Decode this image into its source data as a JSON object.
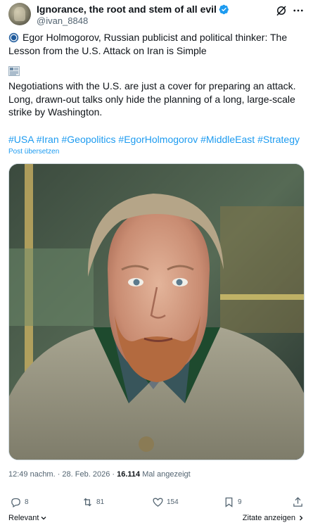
{
  "author": {
    "display_name": "Ignorance, the root and stem of all evil",
    "handle": "@ivan_8848"
  },
  "post": {
    "line1": "Egor Holmogorov, Russian publicist and political thinker: The Lesson from the U.S. Attack on Iran is Simple",
    "paragraph": "Negotiations with the U.S. are just a cover for preparing an attack. Long, drawn-out talks only hide the planning of a long, large-scale strike by Washington.",
    "hashtags": "#USA #Iran #Geopolitics #EgorHolmogorov #MiddleEast #Strategy",
    "translate_label": "Post übersetzen"
  },
  "meta": {
    "time_date": "12:49 nachm. · 28. Feb. 2026 · ",
    "views_count": "16.114",
    "views_label": " Mal angezeigt"
  },
  "actions": {
    "replies": "8",
    "reposts": "81",
    "likes": "154",
    "bookmarks": "9"
  },
  "footer": {
    "sort_label": "Relevant",
    "quotes_label": "Zitate anzeigen"
  },
  "colors": {
    "accent": "#1d9bf0",
    "secondary_text": "#536471",
    "primary_text": "#0f1419"
  },
  "icons": [
    "verified-badge-icon",
    "grok-icon",
    "more-icon",
    "blue-circle-icon",
    "newspaper-icon",
    "reply-icon",
    "repost-icon",
    "like-icon",
    "bookmark-icon",
    "share-icon",
    "chevron-down-icon",
    "chevron-right-icon"
  ]
}
